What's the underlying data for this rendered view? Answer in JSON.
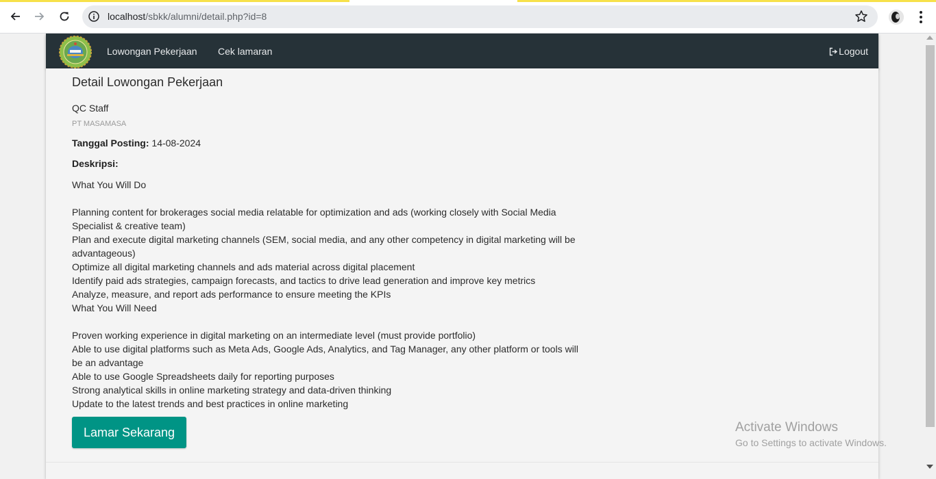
{
  "browser": {
    "url_host": "localhost",
    "url_path": "/sbkk/alumni/detail.php?id=8",
    "icons": [
      "back-icon",
      "forward-icon",
      "reload-icon",
      "site-info-icon",
      "bookmark-star-icon",
      "profile-avatar",
      "kebab-menu-icon"
    ]
  },
  "navbar": {
    "bg_color": "#263238",
    "links": [
      "Lowongan Pekerjaan",
      "Cek lamaran"
    ],
    "logout_label": "Logout"
  },
  "page": {
    "title": "Detail Lowongan Pekerjaan",
    "job_title": "QC Staff",
    "company": "PT MASAMASA",
    "posting_label": "Tanggal Posting:",
    "posting_date": "14-08-2024",
    "description_label": "Deskripsi:",
    "description_lines": [
      "What You Will Do",
      "",
      "Planning content for brokerages social media relatable for optimization and ads (working closely with Social Media Specialist & creative team)",
      "Plan and execute digital marketing channels (SEM, social media, and any other competency in digital marketing will be advantageous)",
      "Optimize all digital marketing channels and ads material across digital placement",
      "Identify paid ads strategies, campaign forecasts, and tactics to drive lead generation and improve key metrics",
      "Analyze, measure, and report ads performance to ensure meeting the KPIs",
      "What You Will Need",
      "",
      "Proven working experience in digital marketing on an intermediate level (must provide portfolio)",
      "Able to use digital platforms such as Meta Ads, Google Ads, Analytics, and Tag Manager, any other platform or tools will be an advantage",
      "Able to use Google Spreadsheets daily for reporting purposes",
      "Strong analytical skills in online marketing strategy and data-driven thinking",
      "Update to the latest trends and best practices in online marketing"
    ],
    "apply_button": "Lamar Sekarang",
    "accent_color": "#009485"
  },
  "watermark": {
    "title": "Activate Windows",
    "subtitle": "Go to Settings to activate Windows."
  }
}
